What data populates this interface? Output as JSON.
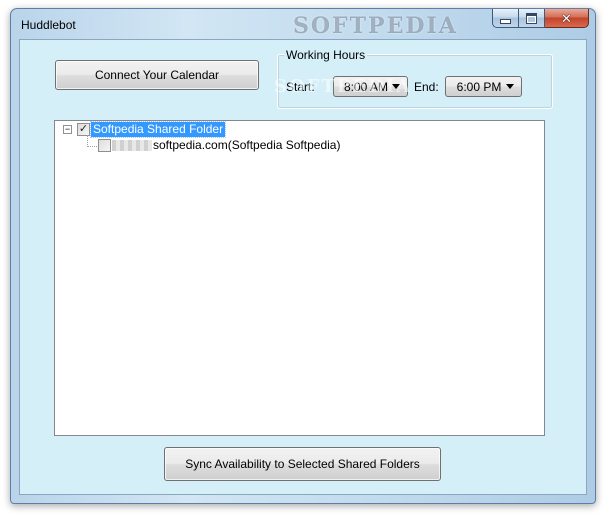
{
  "window": {
    "title": "Huddlebot",
    "watermark": "SOFTPEDIA",
    "watermark_faded": "SOFTPEDIA"
  },
  "caption": {
    "minimize_icon": "minimize-icon",
    "maximize_icon": "maximize-icon",
    "close_icon": "close-icon",
    "close_glyph": "✕"
  },
  "main": {
    "connect_button": "Connect Your Calendar",
    "sync_button": "Sync Availability to Selected Shared Folders"
  },
  "working_hours": {
    "legend": "Working Hours",
    "start_label": "Start:",
    "start_value": "8:00 AM",
    "end_label": "End:",
    "end_value": "6:00 PM"
  },
  "tree": {
    "root": {
      "expander": "⊟",
      "checked": true,
      "check_glyph": "✓",
      "label": "Softpedia Shared Folder",
      "selected": true
    },
    "children": [
      {
        "checked": false,
        "label": "softpedia.com(Softpedia Softpedia)"
      }
    ]
  },
  "colors": {
    "client_background": "#d4eff7",
    "selection": "#3399ff"
  }
}
